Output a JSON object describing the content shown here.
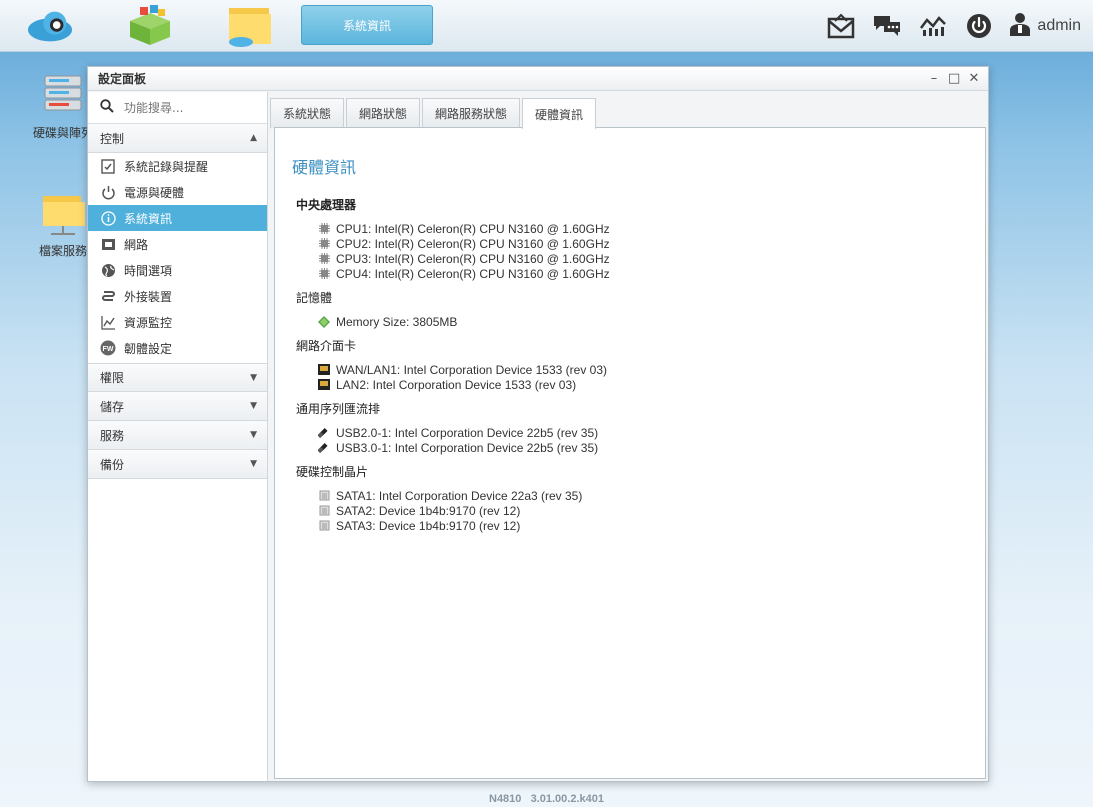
{
  "taskbar": {
    "active_app": "系統資訊",
    "user": "admin",
    "icons": [
      "cloud-icon",
      "app-center-icon",
      "file-manager-icon",
      "mail-icon",
      "chat-icon",
      "dashboard-icon",
      "power-icon",
      "user-icon"
    ]
  },
  "desktop": {
    "icons": [
      {
        "label": "硬碟與陣列",
        "icon": "storage-icon"
      },
      {
        "label": "檔案服務",
        "icon": "folder-icon"
      }
    ]
  },
  "window": {
    "title": "設定面板",
    "controls": [
      "–",
      "□",
      "✕"
    ]
  },
  "sidebar": {
    "search_placeholder": "功能搜尋...",
    "categories": [
      {
        "label": "控制",
        "expanded": true
      },
      {
        "label": "權限"
      },
      {
        "label": "儲存"
      },
      {
        "label": "服務"
      },
      {
        "label": "備份"
      }
    ],
    "items": [
      {
        "label": "系統記錄與提醒",
        "icon": "clipboard-check-icon"
      },
      {
        "label": "電源與硬體",
        "icon": "power-icon"
      },
      {
        "label": "系統資訊",
        "icon": "info-icon",
        "active": true
      },
      {
        "label": "網路",
        "icon": "network-port-icon"
      },
      {
        "label": "時間選項",
        "icon": "globe-icon"
      },
      {
        "label": "外接裝置",
        "icon": "usb-icon"
      },
      {
        "label": "資源監控",
        "icon": "chart-line-icon"
      },
      {
        "label": "韌體設定",
        "icon": "firmware-icon"
      }
    ]
  },
  "tabs": [
    "系統狀態",
    "網路狀態",
    "網路服務狀態",
    "硬體資訊"
  ],
  "active_tab": 3,
  "panel": {
    "title": "硬體資訊",
    "sections": [
      {
        "heading": "中央處理器",
        "icon": "chip-icon",
        "lines": [
          "CPU1: Intel(R) Celeron(R) CPU N3160 @ 1.60GHz",
          "CPU2: Intel(R) Celeron(R) CPU N3160 @ 1.60GHz",
          "CPU3: Intel(R) Celeron(R) CPU N3160 @ 1.60GHz",
          "CPU4: Intel(R) Celeron(R) CPU N3160 @ 1.60GHz"
        ]
      },
      {
        "heading": "記憶體",
        "icon": "memory-icon",
        "lines": [
          "Memory Size: 3805MB"
        ]
      },
      {
        "heading": "網路介面卡",
        "icon": "nic-icon",
        "lines": [
          "WAN/LAN1: Intel Corporation Device 1533 (rev 03)",
          "LAN2: Intel Corporation Device 1533 (rev 03)"
        ]
      },
      {
        "heading": "通用序列匯流排",
        "icon": "usb-plug-icon",
        "lines": [
          "USB2.0-1: Intel Corporation Device 22b5 (rev 35)",
          "USB3.0-1: Intel Corporation Device 22b5 (rev 35)"
        ]
      },
      {
        "heading": "硬碟控制晶片",
        "icon": "disk-controller-icon",
        "lines": [
          "SATA1: Intel Corporation Device 22a3 (rev 35)",
          "SATA2: Device 1b4b:9170 (rev 12)",
          "SATA3: Device 1b4b:9170 (rev 12)"
        ]
      }
    ]
  },
  "footer": "N4810   3.01.00.2.k401"
}
